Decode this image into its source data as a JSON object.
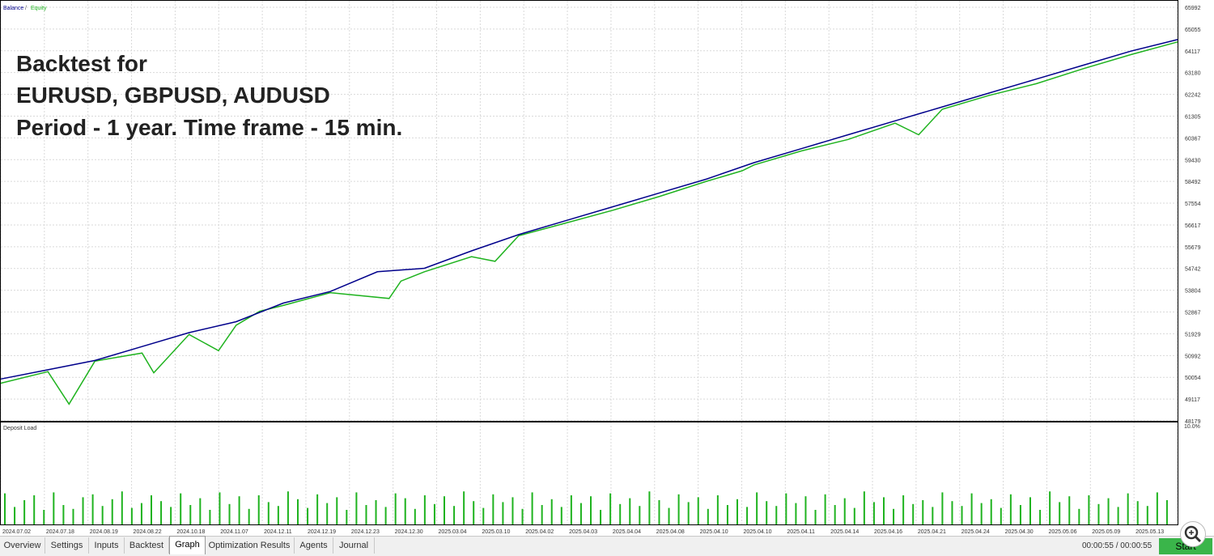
{
  "legend": {
    "balance": "Balance",
    "separator": "/",
    "equity": "Equity"
  },
  "overlay_text": [
    "Backtest for",
    "EURUSD, GBPUSD, AUDUSD",
    "Period - 1 year. Time frame - 15 min."
  ],
  "deposit_load": {
    "label": "Deposit Load",
    "max_label": "10.0%"
  },
  "colors": {
    "balance": "#00008b",
    "equity": "#1fb31f",
    "bars": "#1fb31f",
    "start_button": "#3ab54a"
  },
  "chart_data": [
    {
      "type": "line",
      "title": "",
      "series": [
        {
          "name": "Balance",
          "x": [
            0,
            4,
            8,
            12,
            16,
            20,
            24,
            28,
            32,
            36,
            40,
            44,
            48,
            52,
            56,
            60,
            64,
            68,
            72,
            76,
            80,
            84,
            88,
            92,
            96,
            100
          ],
          "y": [
            49980,
            50380,
            50780,
            51380,
            51980,
            52450,
            53250,
            53750,
            54600,
            54750,
            55500,
            56200,
            56800,
            57400,
            58000,
            58600,
            59300,
            59900,
            60500,
            61100,
            61700,
            62300,
            62900,
            63500,
            64100,
            64600
          ]
        },
        {
          "name": "Equity",
          "x": [
            0,
            4,
            5.8,
            8,
            12,
            13,
            16,
            18.5,
            20,
            22,
            24,
            28,
            33,
            34,
            36,
            40,
            42,
            44,
            48,
            52,
            56,
            60,
            63,
            64,
            68,
            72,
            76,
            78,
            80,
            84,
            88,
            92,
            96,
            100
          ],
          "y": [
            49800,
            50300,
            48900,
            50750,
            51100,
            50250,
            51900,
            51200,
            52300,
            52900,
            53150,
            53700,
            53450,
            54200,
            54600,
            55250,
            55050,
            56150,
            56700,
            57250,
            57850,
            58500,
            58950,
            59200,
            59800,
            60300,
            61000,
            60500,
            61600,
            62200,
            62700,
            63350,
            63950,
            64500
          ]
        }
      ],
      "ylim": [
        48179,
        65992
      ],
      "y_ticks": [
        "65992",
        "65055",
        "64117",
        "63180",
        "62242",
        "61305",
        "60367",
        "59430",
        "58492",
        "57554",
        "56617",
        "55679",
        "54742",
        "53804",
        "52867",
        "51929",
        "50992",
        "50054",
        "49117",
        "48179"
      ],
      "x_labels": [
        "2024.07.02",
        "2024.07.18",
        "2024.08.19",
        "2024.08.22",
        "2024.10.18",
        "2024.11.07",
        "2024.12.11",
        "2024.12.19",
        "2024.12.23",
        "2024.12.30",
        "2025.03.04",
        "2025.03.10",
        "2025.04.02",
        "2025.04.03",
        "2025.04.04",
        "2025.04.08",
        "2025.04.10",
        "2025.04.10",
        "2025.04.11",
        "2025.04.14",
        "2025.04.16",
        "2025.04.21",
        "2025.04.24",
        "2025.04.30",
        "2025.05.06",
        "2025.05.09",
        "2025.05.13"
      ],
      "grid": true,
      "legend_position": "top-left"
    },
    {
      "type": "bar",
      "title": "Deposit Load",
      "ylim": [
        0,
        10
      ],
      "values": [
        3.2,
        1.8,
        2.5,
        3.0,
        1.5,
        3.3,
        2.0,
        1.6,
        2.8,
        3.1,
        1.9,
        2.6,
        3.4,
        1.7,
        2.2,
        3.0,
        2.4,
        1.8,
        3.2,
        2.0,
        2.7,
        1.5,
        3.3,
        2.1,
        2.9,
        1.6,
        3.0,
        2.3,
        1.9,
        3.4,
        2.6,
        1.7,
        3.1,
        2.2,
        2.8,
        1.5,
        3.3,
        2.0,
        2.5,
        1.8,
        3.2,
        2.7,
        1.6,
        3.0,
        2.1,
        2.9,
        1.9,
        3.4,
        2.4,
        1.7,
        3.1,
        2.3,
        2.8,
        1.6,
        3.3,
        2.0,
        2.6,
        1.8,
        3.0,
        2.2,
        2.9,
        1.5,
        3.2,
        2.1,
        2.7,
        1.9,
        3.4,
        2.5,
        1.7,
        3.1,
        2.3,
        2.8,
        1.6,
        3.0,
        2.0,
        2.6,
        1.8,
        3.3,
        2.4,
        1.9,
        3.2,
        2.2,
        2.9,
        1.5,
        3.1,
        2.0,
        2.7,
        1.7,
        3.4,
        2.3,
        2.8,
        1.6,
        3.0,
        2.1,
        2.5,
        1.8,
        3.3,
        2.4,
        1.9,
        3.2,
        2.2,
        2.6,
        1.7,
        3.1,
        2.0,
        2.8,
        1.5,
        3.4,
        2.3,
        2.9,
        1.6,
        3.0,
        2.1,
        2.7,
        1.8,
        3.2,
        2.4,
        1.9,
        3.3,
        2.5
      ]
    }
  ],
  "tabs": [
    {
      "label": "Overview",
      "active": false
    },
    {
      "label": "Settings",
      "active": false
    },
    {
      "label": "Inputs",
      "active": false
    },
    {
      "label": "Backtest",
      "active": false
    },
    {
      "label": "Graph",
      "active": true
    },
    {
      "label": "Optimization Results",
      "active": false
    },
    {
      "label": "Agents",
      "active": false
    },
    {
      "label": "Journal",
      "active": false
    }
  ],
  "status": {
    "timer": "00:00:55 / 00:00:55",
    "start_label": "Start"
  }
}
